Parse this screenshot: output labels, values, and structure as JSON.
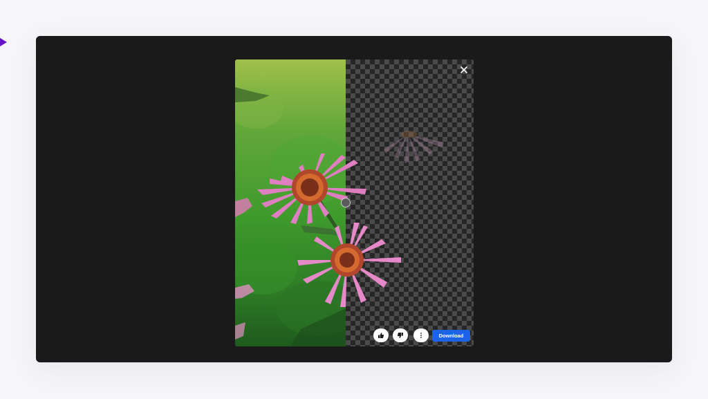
{
  "preview": {
    "close_icon": "close-icon",
    "actions": {
      "like_icon": "thumbs-up-icon",
      "dislike_icon": "thumbs-down-icon",
      "more_icon": "more-vertical-icon",
      "download_label": "Download"
    }
  },
  "colors": {
    "frame_background": "#1a1a1a",
    "download_button": "#1d63e8",
    "page_background": "#f6f6f9",
    "accent_arrow": "#6a14c8"
  }
}
